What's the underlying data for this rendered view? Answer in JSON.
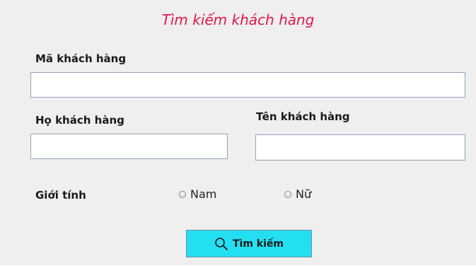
{
  "form": {
    "title": "Tìm kiếm khách hàng",
    "customer_id": {
      "label": "Mã khách hàng",
      "value": ""
    },
    "last_name": {
      "label": "Họ khách hàng",
      "value": ""
    },
    "first_name": {
      "label": "Tên khách hàng",
      "value": ""
    },
    "gender": {
      "label": "Giới tính",
      "options": [
        {
          "label": "Nam",
          "selected": false
        },
        {
          "label": "Nữ",
          "selected": false
        }
      ]
    },
    "search_button": {
      "label": "Tìm kiếm",
      "icon": "search-icon"
    }
  },
  "colors": {
    "title": "#e0174f",
    "panel_background": "#efefef",
    "button_background": "#24dff2",
    "field_border": "#8ea2b8"
  }
}
